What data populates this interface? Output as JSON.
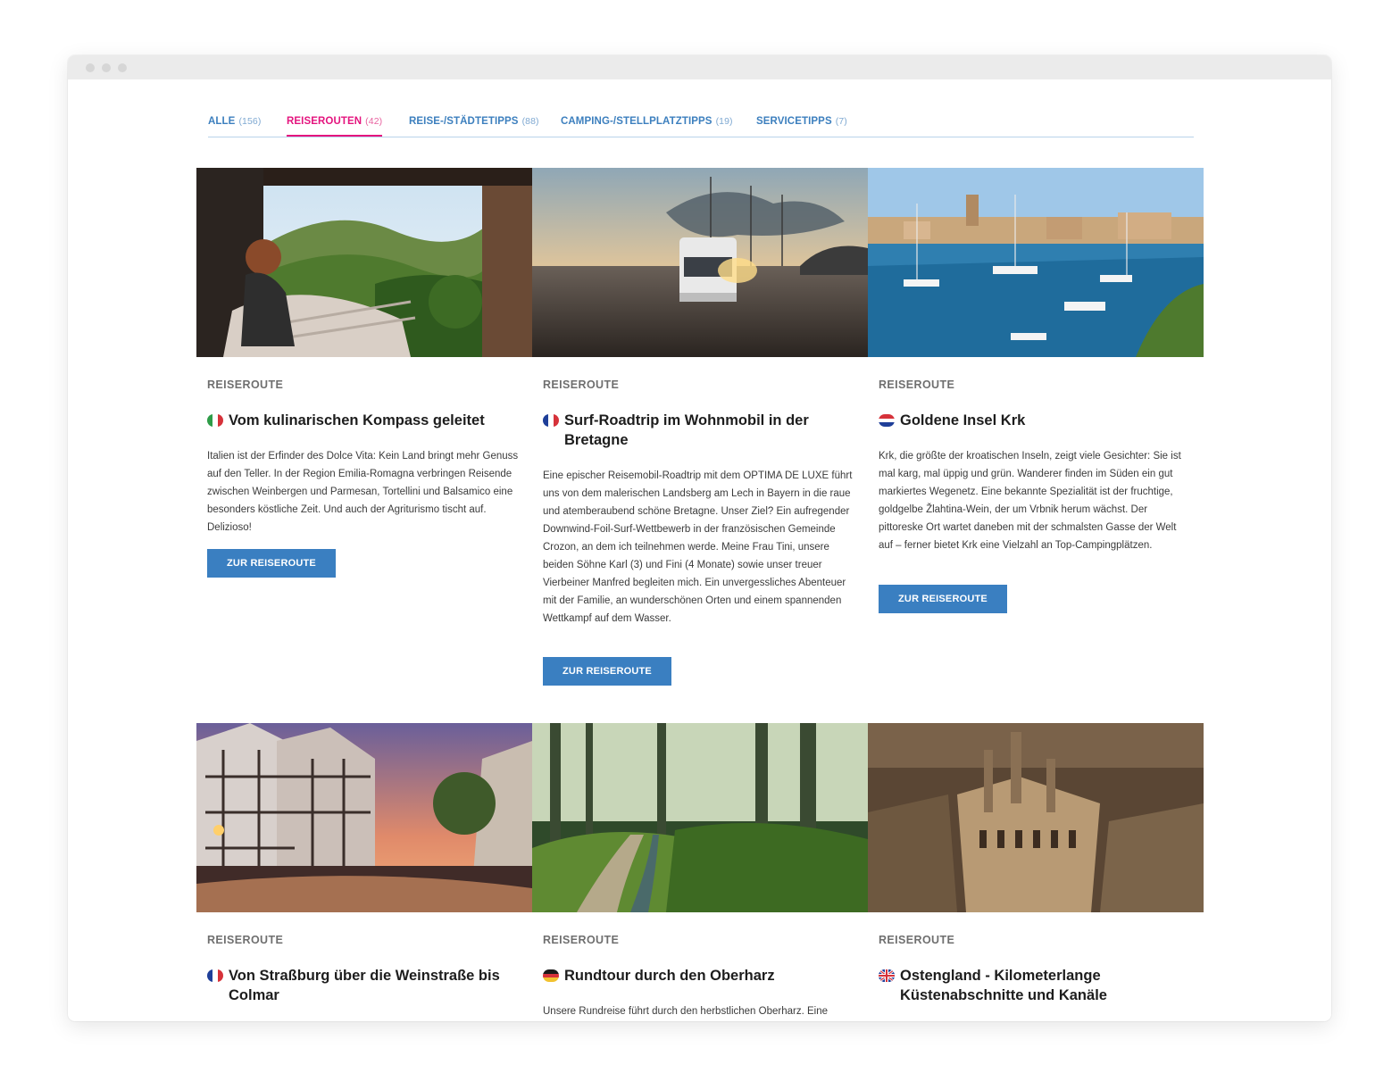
{
  "tabs": [
    {
      "label": "ALLE",
      "count": "(156)"
    },
    {
      "label": "REISEROUTEN",
      "count": "(42)"
    },
    {
      "label": "REISE-/STÄDTETIPPS",
      "count": "(88)"
    },
    {
      "label": "CAMPING-/STELLPLATZTIPPS",
      "count": "(19)"
    },
    {
      "label": "SERVICETIPPS",
      "count": "(7)"
    }
  ],
  "active_tab": "REISEROUTEN",
  "colors": {
    "accent": "#e4147e",
    "link": "#3c7fbe",
    "button": "#3a7fc1"
  },
  "cards": [
    {
      "category": "REISEROUTE",
      "flag": "italy-flag",
      "title": "Vom kulinarischen Kompass geleitet",
      "description": "Italien ist der Erfinder des Dolce Vita: Kein Land bringt mehr Genuss auf den Teller. In der Region Emilia-Romagna verbringen Reisende zwischen Weinbergen und Parmesan, Tortellini und Balsamico eine besonders köstliche Zeit. Und auch der Agriturismo tischt auf. Delizioso!",
      "button": "ZUR REISEROUTE"
    },
    {
      "category": "REISEROUTE",
      "flag": "france-flag",
      "title": "Surf-Roadtrip im Wohnmobil in der Bretagne",
      "description": "Eine epischer Reisemobil-Roadtrip mit dem OPTIMA DE LUXE führt uns von dem malerischen Landsberg am Lech in Bayern in die raue und atemberaubend schöne Bretagne. Unser Ziel? Ein aufregender Downwind-Foil-Surf-Wettbewerb in der französischen Gemeinde Crozon, an dem ich teilnehmen werde. Meine Frau Tini, unsere beiden Söhne Karl (3) und Fini (4 Monate) sowie unser treuer Vierbeiner Manfred begleiten mich. Ein unvergessliches Abenteuer mit der Familie, an wunderschönen Orten und einem spannenden Wettkampf auf dem Wasser.",
      "button": "ZUR REISEROUTE"
    },
    {
      "category": "REISEROUTE",
      "flag": "croatia-flag",
      "title": "Goldene Insel Krk",
      "description": "Krk, die größte der kroatischen Inseln, zeigt viele Gesichter: Sie ist mal karg, mal üppig und grün. Wanderer finden im Süden ein gut markiertes Wegenetz. Eine bekannte Spezialität ist der fruchtige, goldgelbe Žlahtina-Wein, der um Vrbnik herum wächst. Der pittoreske Ort wartet daneben mit der schmalsten Gasse der Welt auf – ferner bietet Krk eine Vielzahl an Top-Campingplätzen.",
      "button": "ZUR REISEROUTE"
    },
    {
      "category": "REISEROUTE",
      "flag": "france-flag",
      "title": "Von Straßburg über die Weinstraße bis Colmar",
      "description": "",
      "button": ""
    },
    {
      "category": "REISEROUTE",
      "flag": "germany-flag",
      "title": "Rundtour durch den Oberharz",
      "description": "Unsere Rundreise führt durch den herbstlichen Oberharz. Eine",
      "button": ""
    },
    {
      "category": "REISEROUTE",
      "flag": "uk-flag",
      "title": "Ostengland - Kilometerlange Küstenabschnitte und Kanäle",
      "description": "",
      "button": ""
    }
  ]
}
